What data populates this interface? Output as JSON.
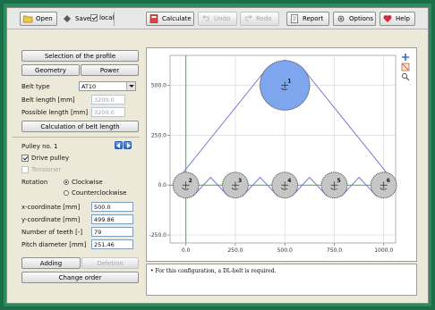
{
  "toolbar": {
    "open": "Open",
    "save": "Save",
    "local": "local",
    "local_checked": true,
    "calculate": "Calculate",
    "undo": "Undo",
    "redo": "Redo",
    "report": "Report",
    "options": "Options",
    "help": "Help"
  },
  "left": {
    "selection_profile": "Selection of the profile",
    "tab_geometry": "Geometry",
    "tab_power": "Power",
    "belt_type_label": "Belt type",
    "belt_type_value": "AT10",
    "belt_length_label": "Belt length [mm]",
    "belt_length_value": "3200.0",
    "possible_length_label": "Possible length [mm]",
    "possible_length_value": "3200.0",
    "calc_belt_length": "Calculation of belt length",
    "pulley_no": "Pulley no. 1",
    "drive_pulley": "Drive pulley",
    "drive_pulley_checked": true,
    "tensioner": "Tensioner",
    "rotation_label": "Rotation",
    "clockwise": "Clockwise",
    "counterclockwise": "Counterclockwise",
    "x_label": "x-coordinate [mm]",
    "x_value": "500.0",
    "y_label": "y-coordinate [mm]",
    "y_value": "499.86",
    "teeth_label": "Number of teeth [-]",
    "teeth_value": "79",
    "pitch_label": "Pitch diameter [mm]",
    "pitch_value": "251.46",
    "adding": "Adding",
    "deletion": "Deletion",
    "change_order": "Change order"
  },
  "chart_data": {
    "type": "scatter",
    "title": "",
    "xlabel": "",
    "ylabel": "",
    "x_ticks": [
      "0.0",
      "250.0",
      "500.0",
      "750.0",
      "1000.0"
    ],
    "y_ticks": [
      "500.0",
      "250.0",
      "0.0",
      "-250.0"
    ],
    "xlim": [
      -80,
      1060
    ],
    "ylim": [
      -290,
      650
    ],
    "pulleys": [
      {
        "id": "1",
        "x": 500,
        "y": 500,
        "d": 251.46,
        "selected": true
      },
      {
        "id": "2",
        "x": 0,
        "y": 0,
        "d": 130
      },
      {
        "id": "3",
        "x": 250,
        "y": 0,
        "d": 130
      },
      {
        "id": "4",
        "x": 500,
        "y": 0,
        "d": 130
      },
      {
        "id": "5",
        "x": 750,
        "y": 0,
        "d": 130
      },
      {
        "id": "6",
        "x": 1000,
        "y": 0,
        "d": 130
      }
    ],
    "colors": {
      "belt": "#7b78d8",
      "selected_fill": "#7ea6ef",
      "pulley_fill": "#c6c6c6",
      "axis_marker": "#3cb043",
      "grid": "#d8d8d8"
    }
  },
  "message": "For this configuration, a DL-belt is required."
}
